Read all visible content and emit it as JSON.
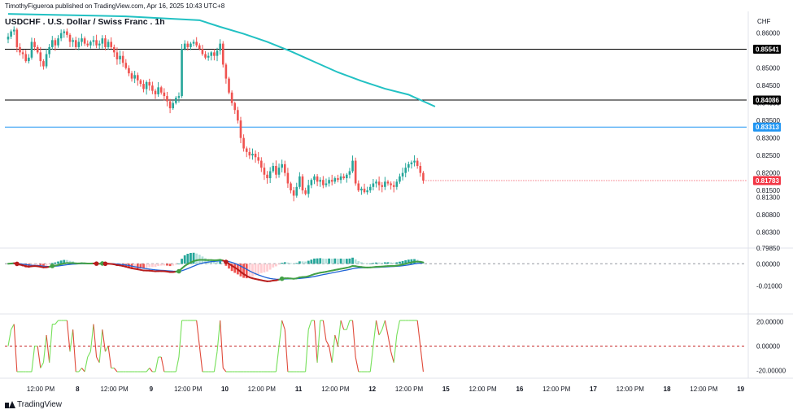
{
  "header": {
    "publisher_line": "TimothyFigueroa published on TradingView.com, Apr 16, 2025 10:43 UTC+8",
    "symbol_title": "USDCHF . U.S. Dollar / Swiss Franc . 1h",
    "currency": "CHF"
  },
  "footer": {
    "brand": "TradingView"
  },
  "colors": {
    "up": "#26a69a",
    "down": "#ef5350",
    "ma": "#22c1c3",
    "hline_black": "#000000",
    "hline_blue": "#2196f3",
    "price_tag": "#f23645",
    "fast": "#43a047",
    "slow": "#1e63d6",
    "fast_down": "#b71c1c",
    "osc_up": "#76e05a",
    "osc_down": "#e04a3a"
  },
  "chart_data": [
    {
      "type": "candlestick",
      "title": "USDCHF . U.S. Dollar / Swiss Franc . 1h",
      "ylim": [
        0.7985,
        0.8625
      ],
      "y_ticks": [
        "0.86000",
        "0.85500",
        "0.85000",
        "0.84500",
        "0.84000",
        "0.83500",
        "0.83000",
        "0.82500",
        "0.82000",
        "0.81500",
        "0.81300",
        "0.80800",
        "0.80300",
        "0.79850"
      ],
      "x_ticks": [
        "12:00 PM",
        "8",
        "12:00 PM",
        "9",
        "12:00 PM",
        "10",
        "12:00 PM",
        "11",
        "12:00 PM",
        "12",
        "12:00 PM",
        "15",
        "12:00 PM",
        "16",
        "12:00 PM",
        "17",
        "12:00 PM",
        "18",
        "12:00 PM",
        "19"
      ],
      "horizontal_lines": [
        {
          "value": 0.85541,
          "label": "0.85541",
          "color": "#000000"
        },
        {
          "value": 0.84086,
          "label": "0.84086",
          "color": "#000000"
        },
        {
          "value": 0.83313,
          "label": "0.83313",
          "color": "#2196f3"
        }
      ],
      "last_price": {
        "value": 0.81783,
        "label": "0.81783"
      },
      "moving_average": [
        [
          0,
          0.8655
        ],
        [
          40,
          0.8648
        ],
        [
          65,
          0.8637
        ],
        [
          72,
          0.8618
        ],
        [
          80,
          0.8598
        ],
        [
          88,
          0.8575
        ],
        [
          96,
          0.8548
        ],
        [
          104,
          0.8518
        ],
        [
          112,
          0.8488
        ],
        [
          120,
          0.8463
        ],
        [
          128,
          0.8441
        ],
        [
          136,
          0.8424
        ],
        [
          145,
          0.839
        ]
      ],
      "closes": [
        0.859,
        0.8605,
        0.861,
        0.856,
        0.8545,
        0.854,
        0.852,
        0.853,
        0.8575,
        0.856,
        0.8545,
        0.852,
        0.8505,
        0.854,
        0.856,
        0.858,
        0.8565,
        0.8585,
        0.86,
        0.8605,
        0.8595,
        0.8575,
        0.858,
        0.856,
        0.8575,
        0.8585,
        0.857,
        0.8565,
        0.8575,
        0.858,
        0.8565,
        0.857,
        0.8585,
        0.856,
        0.8575,
        0.856,
        0.8545,
        0.8525,
        0.8535,
        0.8515,
        0.85,
        0.8485,
        0.847,
        0.848,
        0.8465,
        0.8455,
        0.844,
        0.846,
        0.845,
        0.8435,
        0.8425,
        0.8445,
        0.843,
        0.842,
        0.8405,
        0.8385,
        0.84,
        0.8415,
        0.842,
        0.8555,
        0.857,
        0.856,
        0.857,
        0.8575,
        0.8565,
        0.8555,
        0.854,
        0.853,
        0.8535,
        0.8545,
        0.8535,
        0.855,
        0.857,
        0.851,
        0.847,
        0.843,
        0.84,
        0.838,
        0.835,
        0.83,
        0.827,
        0.826,
        0.825,
        0.8255,
        0.8245,
        0.8235,
        0.8215,
        0.8195,
        0.8185,
        0.8205,
        0.822,
        0.8195,
        0.8215,
        0.8225,
        0.82,
        0.817,
        0.815,
        0.8135,
        0.816,
        0.819,
        0.815,
        0.814,
        0.8165,
        0.818,
        0.819,
        0.8175,
        0.818,
        0.8165,
        0.817,
        0.818,
        0.8175,
        0.8185,
        0.818,
        0.819,
        0.8185,
        0.8195,
        0.8205,
        0.8235,
        0.817,
        0.815,
        0.8155,
        0.8145,
        0.815,
        0.816,
        0.817,
        0.8175,
        0.8165,
        0.816,
        0.8175,
        0.817,
        0.8165,
        0.816,
        0.8175,
        0.819,
        0.82,
        0.8215,
        0.8225,
        0.823,
        0.8235,
        0.822,
        0.82,
        0.8178
      ]
    },
    {
      "type": "histogram+line",
      "ylim": [
        -0.022,
        0.006
      ],
      "y_ticks": [
        "0.00000",
        "-0.01000"
      ]
    },
    {
      "type": "line",
      "ylim": [
        -25,
        25
      ],
      "y_ticks": [
        "20.00000",
        "0.00000",
        "-20.00000"
      ]
    }
  ]
}
